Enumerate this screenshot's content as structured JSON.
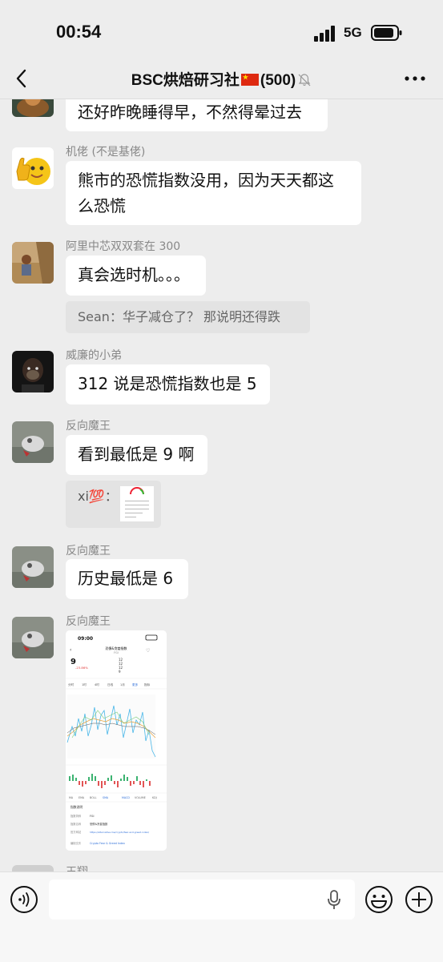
{
  "status": {
    "time": "00:54",
    "network": "5G"
  },
  "header": {
    "title": "BSC烘焙研习社",
    "count": "(500)"
  },
  "messages": [
    {
      "text": "还好昨晚睡得早，不然得晕过去"
    },
    {
      "sender": "机佬 (不是基佬)",
      "text_line1": "熊市的恐慌指数没用，因为天天都这",
      "text_line2": "么恐慌"
    },
    {
      "sender": "阿里中芯双双套在 300",
      "text": "真会选时机。。。",
      "quote": "Sean：华子减仓了？ 那说明还得跌"
    },
    {
      "sender": "威廉的小弟",
      "text": "312 说是恐慌指数也是 5"
    },
    {
      "sender": "反向魔王",
      "text": "看到最低是 9 啊",
      "quote_name": "xi💯："
    },
    {
      "sender": "反向魔王",
      "text": "历史最低是 6"
    },
    {
      "sender": "反向魔王"
    }
  ],
  "partial_sender": "王翔",
  "screenshot": {
    "time": "09:00",
    "title": "恐惧&贪婪指数",
    "subtitle": "FGI",
    "value": "9",
    "change": "-23.86%",
    "side_values": [
      "12",
      "12",
      "12",
      "9"
    ],
    "tabs": [
      "分时",
      "1时",
      "4时",
      "日线",
      "1月",
      "更多",
      "指标"
    ],
    "indicators": [
      "MA",
      "EMA",
      "BOLL",
      "SMA",
      "MACD",
      "VOLUME",
      "KDJ"
    ],
    "info_title": "指数说明",
    "info_rows": [
      {
        "k": "指数简称",
        "v": "FGI"
      },
      {
        "k": "指数名称",
        "v": "恐惧&贪婪指数"
      },
      {
        "k": "官方网站",
        "v": "https://alternative.me/crypto/fear-and-greed-index/"
      },
      {
        "k": "编制文件",
        "v": "Crypto Fear & Greed Index"
      }
    ]
  }
}
